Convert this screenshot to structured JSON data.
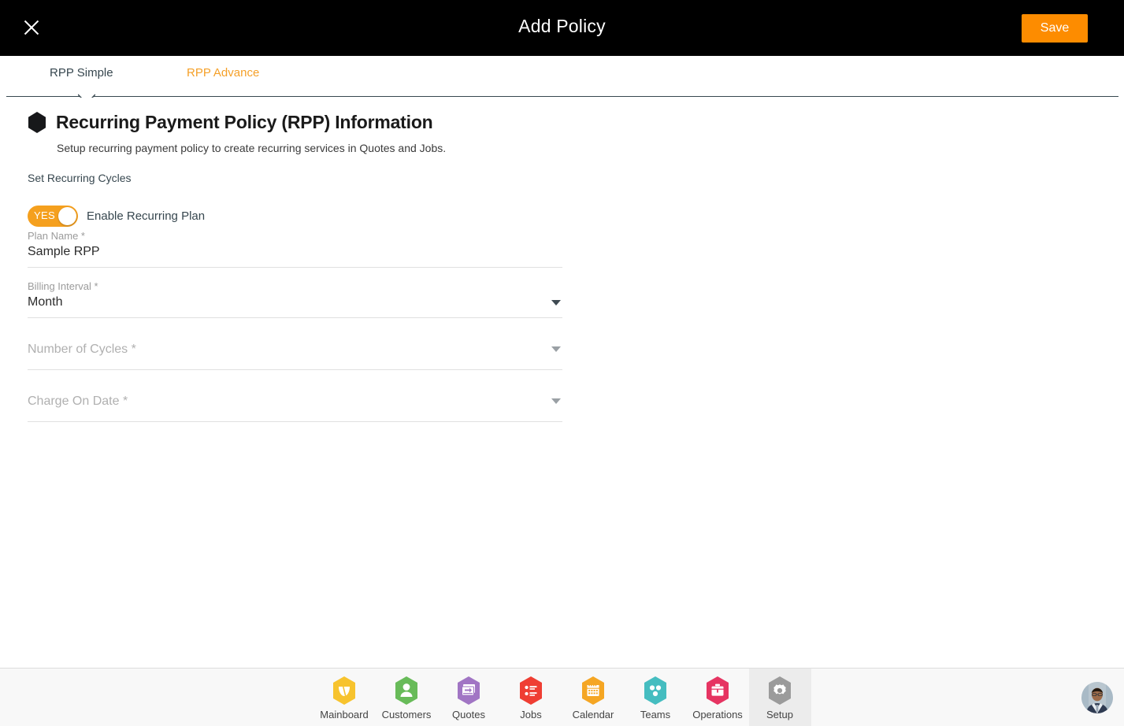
{
  "topbar": {
    "close_icon": "close-icon",
    "title": "Add Policy",
    "save_label": "Save",
    "accent_color": "#fd8c00"
  },
  "tabs": {
    "items": [
      {
        "label": "RPP Simple",
        "active": true,
        "color": "#37474f"
      },
      {
        "label": "RPP Advance",
        "active": false,
        "color": "#f5a028"
      }
    ]
  },
  "section": {
    "bullet_icon": "hexagon-icon",
    "title": "Recurring Payment Policy (RPP) Information",
    "subtitle": "Setup recurring payment policy to create recurring services in Quotes and Jobs.",
    "group_label": "Set Recurring Cycles"
  },
  "toggle": {
    "state_text": "YES",
    "label": "Enable Recurring Plan",
    "on": true,
    "color": "#f5a01e"
  },
  "fields": [
    {
      "name": "plan-name",
      "label": "Plan Name *",
      "value": "Sample RPP",
      "placeholder": "Plan Name *",
      "type": "text",
      "filled": true
    },
    {
      "name": "billing-interval",
      "label": "Billing Interval *",
      "value": "Month",
      "placeholder": "Billing Interval *",
      "type": "select",
      "filled": true
    },
    {
      "name": "number-of-cycles",
      "label": "Number of Cycles *",
      "value": "",
      "placeholder": "Number of Cycles *",
      "type": "select",
      "filled": false
    },
    {
      "name": "charge-on-date",
      "label": "Charge On Date *",
      "value": "",
      "placeholder": "Charge On Date *",
      "type": "select",
      "filled": false
    }
  ],
  "bottom_nav": {
    "items": [
      {
        "label": "Mainboard",
        "icon": "mainboard-icon",
        "color": "#f7c32e",
        "active": false
      },
      {
        "label": "Customers",
        "icon": "customers-icon",
        "color": "#68bb59",
        "active": false
      },
      {
        "label": "Quotes",
        "icon": "quotes-icon",
        "color": "#a175c4",
        "active": false
      },
      {
        "label": "Jobs",
        "icon": "jobs-icon",
        "color": "#ef3e33",
        "active": false
      },
      {
        "label": "Calendar",
        "icon": "calendar-icon",
        "color": "#f5a623",
        "active": false
      },
      {
        "label": "Teams",
        "icon": "teams-icon",
        "color": "#45bdc0",
        "active": false
      },
      {
        "label": "Operations",
        "icon": "operations-icon",
        "color": "#e63462",
        "active": false
      },
      {
        "label": "Setup",
        "icon": "setup-icon",
        "color": "#9b9b9b",
        "active": true
      }
    ],
    "avatar_icon": "user-avatar"
  }
}
